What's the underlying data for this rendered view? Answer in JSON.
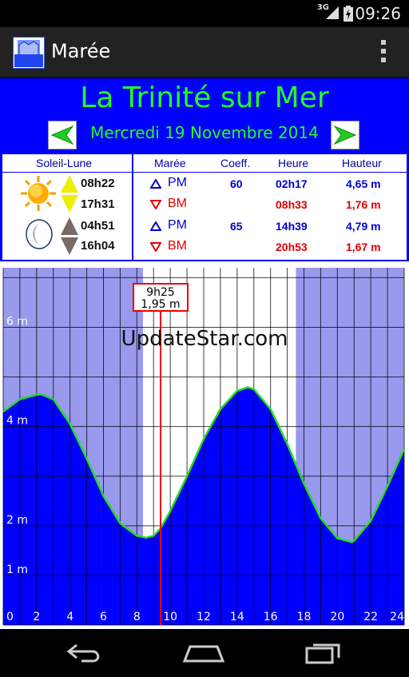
{
  "status_bar": {
    "time": "09:26",
    "network": "3G"
  },
  "action_bar": {
    "title": "Marée"
  },
  "header": {
    "place": "La Trinité sur Mer",
    "date": "Mercredi 19 Novembre 2014"
  },
  "table": {
    "headers": {
      "sun_moon": "Soleil-Lune",
      "tide": "Marée",
      "coeff": "Coeff.",
      "time": "Heure",
      "height": "Hauteur"
    },
    "sun": {
      "rise": "08h22",
      "set": "17h31"
    },
    "moon": {
      "rise": "04h51",
      "set": "16h04"
    },
    "rows": [
      {
        "type": "PM",
        "coeff": "60",
        "time": "02h17",
        "height": "4,65 m",
        "color": "#0000cc"
      },
      {
        "type": "BM",
        "coeff": "",
        "time": "08h33",
        "height": "1,76 m",
        "color": "#e00000"
      },
      {
        "type": "PM",
        "coeff": "65",
        "time": "14h39",
        "height": "4,79 m",
        "color": "#0000cc"
      },
      {
        "type": "BM",
        "coeff": "",
        "time": "20h53",
        "height": "1,67 m",
        "color": "#e00000"
      }
    ]
  },
  "cursor": {
    "time": "9h25",
    "height": "1,95 m",
    "hour_decimal": 9.42
  },
  "watermark": "UpdateStar.com",
  "chart_data": {
    "type": "area",
    "x": [
      0,
      1,
      2,
      2.28,
      3,
      4,
      5,
      6,
      7,
      8,
      8.55,
      9,
      9.42,
      10,
      11,
      12,
      13,
      14,
      14.65,
      15,
      16,
      17,
      18,
      19,
      20,
      20.88,
      21,
      22,
      23,
      24
    ],
    "values": [
      4.3,
      4.55,
      4.64,
      4.65,
      4.55,
      4.05,
      3.35,
      2.6,
      2.05,
      1.8,
      1.76,
      1.8,
      1.95,
      2.3,
      3.0,
      3.75,
      4.35,
      4.72,
      4.79,
      4.75,
      4.35,
      3.65,
      2.85,
      2.15,
      1.75,
      1.67,
      1.7,
      2.1,
      2.8,
      3.55
    ],
    "xlim": [
      0,
      24
    ],
    "ylim": [
      0,
      7.2
    ],
    "xticks": [
      "0",
      "2",
      "4",
      "6",
      "8",
      "10",
      "12",
      "14",
      "16",
      "18",
      "20",
      "22",
      "24"
    ],
    "yticks": [
      {
        "value": 1,
        "label": "1 m"
      },
      {
        "value": 2,
        "label": "2 m"
      },
      {
        "value": 4,
        "label": "4 m"
      },
      {
        "value": 6,
        "label": "6 m"
      }
    ],
    "daylight": [
      8.37,
      17.52
    ],
    "grid": true,
    "colors": {
      "area": "#0000ff",
      "curve": "#22dd22",
      "night": "#9999ee",
      "day": "#ffffff",
      "cursor": "#ee0000"
    }
  }
}
